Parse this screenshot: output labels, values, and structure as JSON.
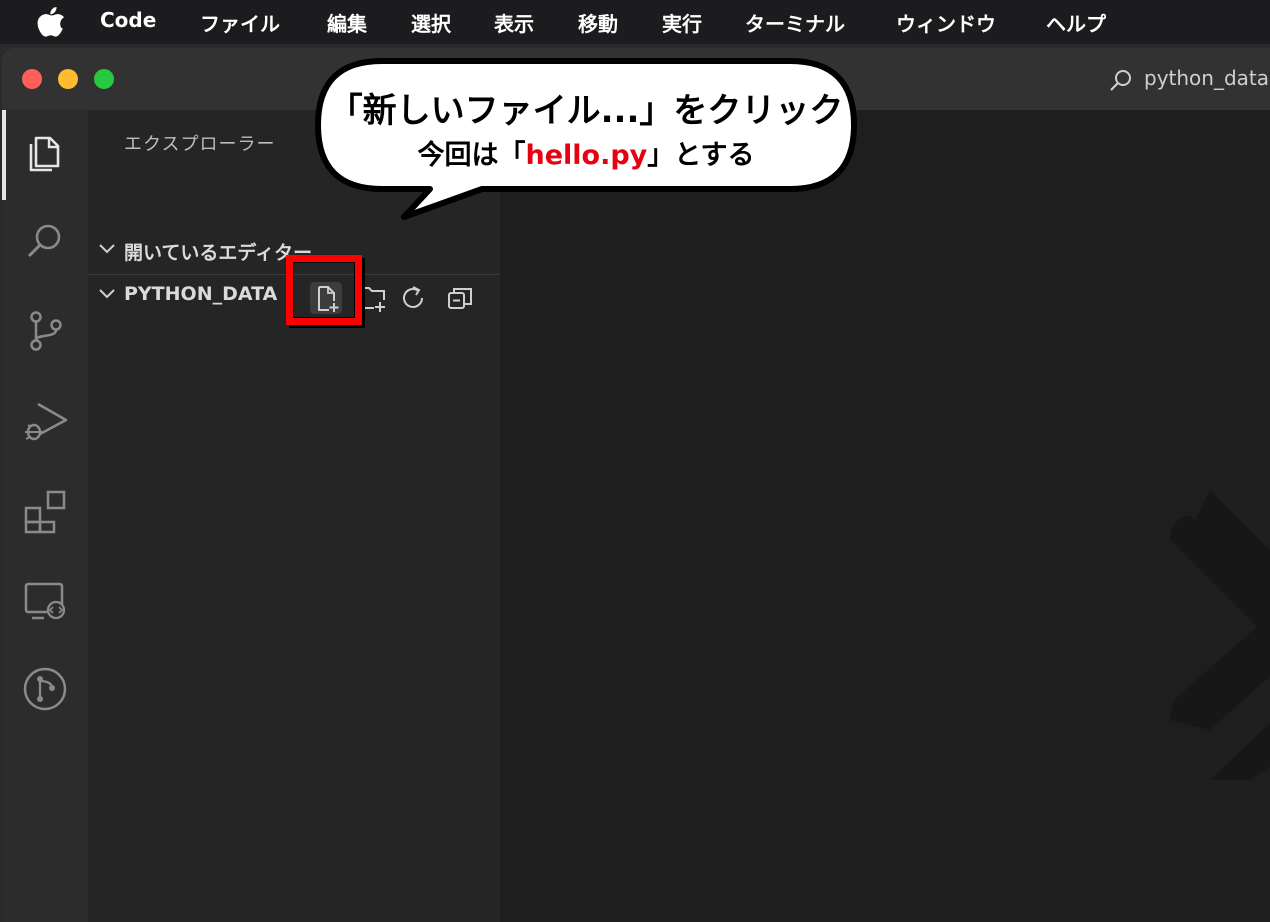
{
  "menubar": {
    "app_name": "Code",
    "items": [
      "ファイル",
      "編集",
      "選択",
      "表示",
      "移動",
      "実行",
      "ターミナル",
      "ウィンドウ",
      "ヘルプ"
    ]
  },
  "window": {
    "search_text": "python_data"
  },
  "activity_bar": {
    "icons": [
      "explorer-icon",
      "search-icon",
      "source-control-icon",
      "run-debug-icon",
      "extensions-icon",
      "remote-explorer-icon",
      "git-graph-icon"
    ]
  },
  "sidebar": {
    "title": "エクスプローラー",
    "open_editors_label": "開いているエディター",
    "project_label": "PYTHON_DATA",
    "tools": [
      "new-file-icon",
      "new-folder-icon",
      "refresh-icon",
      "collapse-all-icon"
    ]
  },
  "callout": {
    "line1": "「新しいファイル...」をクリック",
    "line2_prefix": "今回は「",
    "line2_highlight": "hello.py",
    "line2_suffix": "」とする",
    "highlight_color": "#e60012"
  },
  "colors": {
    "menubar_bg": "#1c1c1e",
    "activity_bg": "#2c2c2c",
    "sidebar_bg": "#252526",
    "editor_bg": "#1e1e1e",
    "annotation_red": "#ff0000"
  }
}
